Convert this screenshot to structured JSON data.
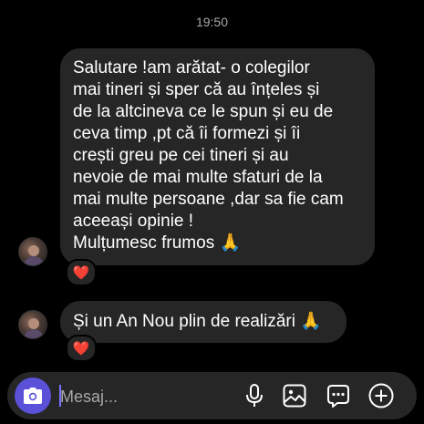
{
  "timestamp": "19:50",
  "messages": [
    {
      "lines": [
        "Salutare !am arătat- o colegilor",
        "mai tineri și sper că au înțeles  și",
        "de la altcineva ce le spun și eu de",
        "ceva timp ,pt că îi formezi și îi",
        "crești greu pe cei tineri și au",
        "nevoie de mai multe sfaturi de la",
        "mai multe persoane ,dar sa fie cam",
        "aceeași opinie !",
        "Mulțumesc frumos 🙏"
      ],
      "reaction": "❤️"
    },
    {
      "text": "Și un An Nou plin de realizări 🙏",
      "reaction": "❤️"
    }
  ],
  "composer": {
    "placeholder": "Mesaj...",
    "icons": [
      "camera-icon",
      "microphone-icon",
      "image-icon",
      "sticker-icon",
      "add-icon"
    ],
    "camera_button_color": "#5b51d8"
  },
  "colors": {
    "background": "#000000",
    "bubble": "#262626",
    "heart": "#e0245e"
  }
}
